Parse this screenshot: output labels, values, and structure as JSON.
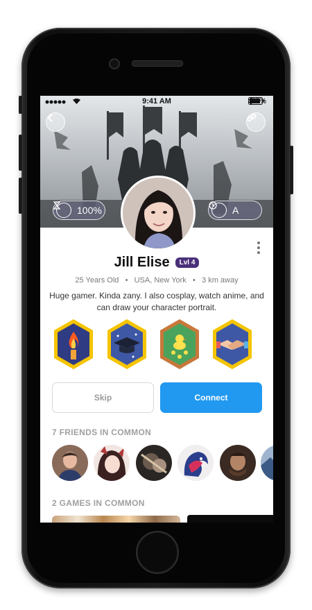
{
  "status": {
    "time": "9:41 AM",
    "battery": "77%"
  },
  "cover": {
    "completeness": "100%",
    "activity_label": "A"
  },
  "profile": {
    "name": "Jill Elise",
    "level": "Lvl 4",
    "age": "25 Years Old",
    "location": "USA, New York",
    "distance": "3 km away",
    "bio": "Huge gamer. Kinda zany. I also cosplay, watch anime, and can draw your character portrait."
  },
  "badges": [
    {
      "icon": "torch-icon"
    },
    {
      "icon": "graduation-cap-icon"
    },
    {
      "icon": "ducks-icon"
    },
    {
      "icon": "handshake-icon"
    }
  ],
  "actions": {
    "skip_label": "Skip",
    "connect_label": "Connect"
  },
  "friends": {
    "title": "7 FRIENDS IN COMMON"
  },
  "games": {
    "title": "2 GAMES IN COMMON"
  },
  "colors": {
    "accent": "#2199f0",
    "level_badge": "#4b2f7a",
    "badge_ring": "#f5c400"
  }
}
